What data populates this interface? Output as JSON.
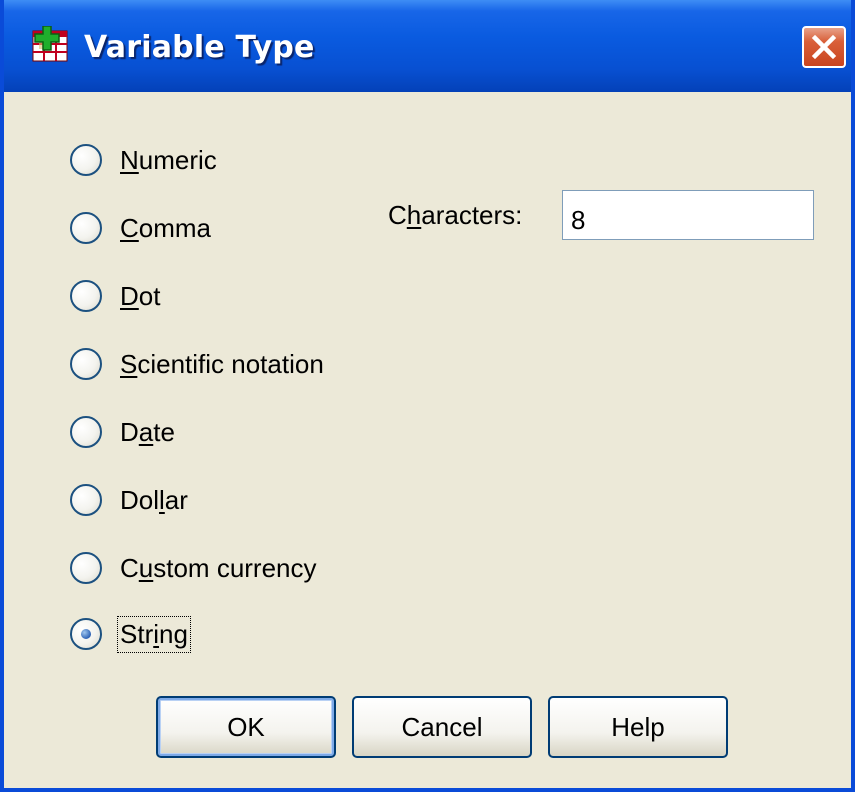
{
  "window": {
    "title": "Variable Type",
    "icon": "spss-variable-icon",
    "close_icon": "close-icon"
  },
  "types": {
    "options": [
      {
        "label": "Numeric",
        "mnemonic_index": 0,
        "selected": false
      },
      {
        "label": "Comma",
        "mnemonic_index": 0,
        "selected": false
      },
      {
        "label": "Dot",
        "mnemonic_index": 0,
        "selected": false
      },
      {
        "label": "Scientific notation",
        "mnemonic_index": 0,
        "selected": false
      },
      {
        "label": "Date",
        "mnemonic_index": 1,
        "selected": false
      },
      {
        "label": "Dollar",
        "mnemonic_index": 3,
        "selected": false
      },
      {
        "label": "Custom currency",
        "mnemonic_index": 1,
        "selected": false
      },
      {
        "label": "String",
        "mnemonic_index": 3,
        "selected": true
      }
    ]
  },
  "characters": {
    "label": "Characters:",
    "label_mnemonic_index": 1,
    "value": "8"
  },
  "buttons": {
    "ok": "OK",
    "cancel": "Cancel",
    "help": "Help"
  },
  "colors": {
    "titlebar": "#0A5BE0",
    "dialog_bg": "#ECE9D8",
    "close_button": "#D9603A",
    "border": "#0A4BD8"
  }
}
